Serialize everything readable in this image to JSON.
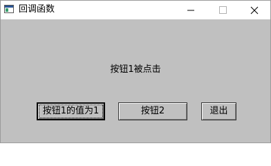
{
  "window": {
    "title": "回调函数",
    "icon": "app-window-icon",
    "controls": {
      "minimize_glyph": "—",
      "close_glyph": "✕"
    }
  },
  "content": {
    "status_text": "按钮1被点击",
    "buttons": [
      {
        "label": "按钮1的值为1",
        "focused": true
      },
      {
        "label": "按钮2",
        "focused": false
      },
      {
        "label": "退出",
        "focused": false
      }
    ]
  },
  "colors": {
    "client_background": "#c0c0c0",
    "titlebar_background": "#ffffff"
  }
}
